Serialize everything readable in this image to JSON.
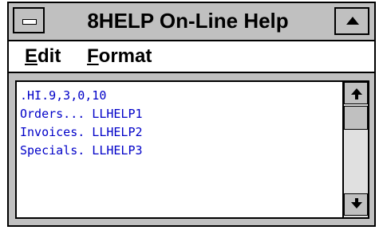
{
  "window": {
    "title": "8HELP On-Line Help"
  },
  "menu": [
    {
      "underline": "E",
      "rest": "dit"
    },
    {
      "underline": "F",
      "rest": "ormat"
    }
  ],
  "content": {
    "lines": [
      ".HI.9,3,0,10",
      "Orders... LLHELP1",
      "Invoices. LLHELP2",
      "Specials. LLHELP3"
    ]
  },
  "icons": {
    "system_menu": "minus-icon",
    "maximize": "triangle-up-icon",
    "scroll_up": "arrow-up-icon",
    "scroll_down": "arrow-down-icon"
  },
  "colors": {
    "text": "#0000c8",
    "frame": "#000000",
    "chrome": "#c0c0c0"
  }
}
